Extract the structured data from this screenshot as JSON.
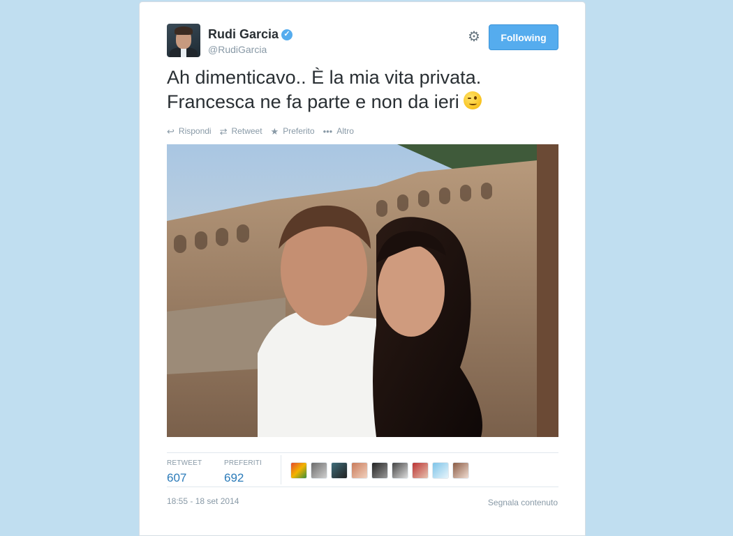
{
  "tweet": {
    "author_name": "Rudi Garcia",
    "handle": "@RudiGarcia",
    "verified_icon": "verified-icon",
    "follow_button_label": "Following",
    "text_line1": "Ah dimenticavo.. È la mia vita privata.",
    "text_line2": "Francesca ne fa parte e non da ieri",
    "emoji": "winking-face-emoji",
    "actions": [
      {
        "label": "Rispondi",
        "icon": "reply-icon"
      },
      {
        "label": "Retweet",
        "icon": "retweet-icon"
      },
      {
        "label": "Preferito",
        "icon": "star-icon"
      },
      {
        "label": "Altro",
        "icon": "more-icon"
      }
    ],
    "stats": {
      "retweet_label": "RETWEET",
      "retweet_count": "607",
      "favorites_label": "PREFERITI",
      "favorites_count": "692"
    },
    "favoriter_count_shown": 9,
    "timestamp": "18:55 - 18 set 2014",
    "report_label": "Segnala contenuto"
  },
  "colors": {
    "page_background": "#c0def0",
    "accent": "#55acee",
    "link": "#2b7bb9",
    "muted": "#8899a6",
    "text": "#292f33"
  }
}
